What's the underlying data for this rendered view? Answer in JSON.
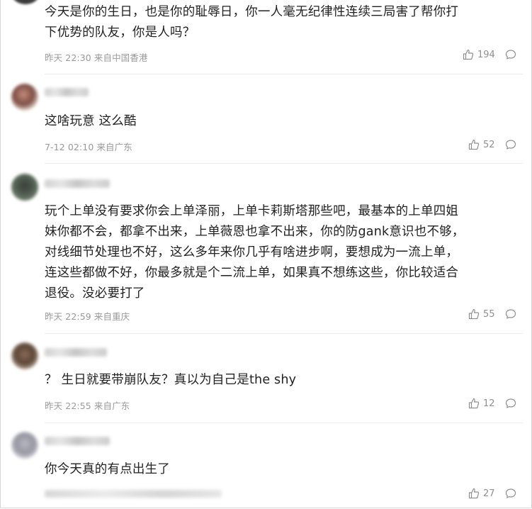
{
  "comments": [
    {
      "text": "今天是你的生日，也是你的耻辱日，你一人毫无纪律性连续三局害了帮你打下优势的队友，你是人吗？",
      "text_lines": [
        "今天是你的生日，也是你的耻辱日，你一人毫无纪律性连续三局害了帮你打",
        "下优势的队友，你是人吗？"
      ],
      "time": "昨天 22:30",
      "location": "来自中国香港",
      "likes": "194"
    },
    {
      "text": "这啥玩意 这么酷",
      "time": "7-12 02:10",
      "location": "来自广东",
      "likes": "52"
    },
    {
      "text": "玩个上单没有要求你会上单泽丽，上单卡莉斯塔那些吧，最基本的上单四姐妹你都不会，都拿不出来，上单薇恩也拿不出来，你的防gank意识也不够，对线细节处理也不好，这么多年来你几乎有啥进步啊，要想成为一流上单，连这些都做不好，你最多就是个二流上单，如果真不想练这些，你比较适合退役。没必要打了",
      "text_lines": [
        "玩个上单没有要求你会上单泽丽，上单卡莉斯塔那些吧，最基本的上单四姐",
        "妹你都不会，都拿不出来，上单薇恩也拿不出来，你的防gank意识也不够，",
        "对线细节处理也不好，这么多年来你几乎有啥进步啊，要想成为一流上单，",
        "连这些都做不好，你最多就是个二流上单，如果真不想练这些，你比较适合",
        "退役。没必要打了"
      ],
      "time": "昨天 22:59",
      "location": "来自重庆",
      "likes": "55"
    },
    {
      "text": "？ 生日就要带崩队友？真以为自己是the shy",
      "time": "昨天 22:55",
      "location": "来自广东",
      "likes": "12"
    },
    {
      "text": "你今天真的有点出生了",
      "likes": "27"
    }
  ],
  "icons": {
    "like": "thumbs-up-icon",
    "reply": "comment-bubble-icon"
  },
  "colors": {
    "text": "#222222",
    "meta": "#9a9a9a",
    "divider": "#ececec"
  }
}
